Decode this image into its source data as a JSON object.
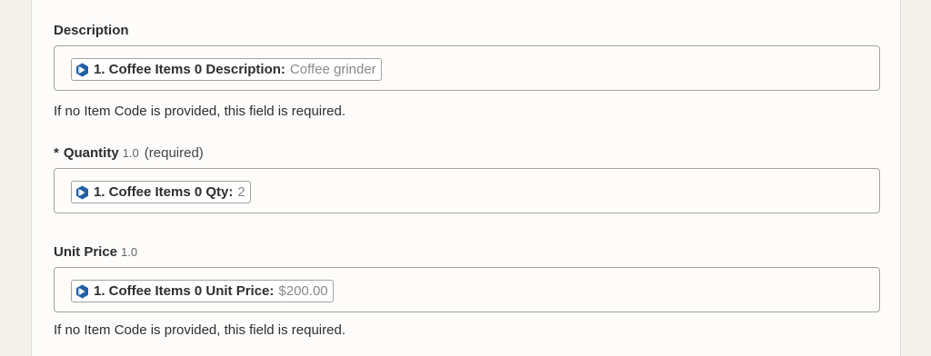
{
  "fields": {
    "description": {
      "label": "Description",
      "pill_label": "1. Coffee Items 0 Description:",
      "pill_value": "Coffee grinder",
      "help": "If no Item Code is provided, this field is required."
    },
    "quantity": {
      "required_marker": "*",
      "label": "Quantity",
      "version": "1.0",
      "required_text": "(required)",
      "pill_label": "1. Coffee Items 0 Qty:",
      "pill_value": "2"
    },
    "unit_price": {
      "label": "Unit Price",
      "version": "1.0",
      "pill_label": "1. Coffee Items 0 Unit Price:",
      "pill_value": "$200.00",
      "help": "If no Item Code is provided, this field is required."
    }
  },
  "colors": {
    "app_icon": "#1f5fa6",
    "panel_background": "#fdfcfa",
    "page_background": "#f3f1ec",
    "border": "#a6a39c"
  },
  "icons": {
    "app_icon": "app-logo-icon"
  }
}
